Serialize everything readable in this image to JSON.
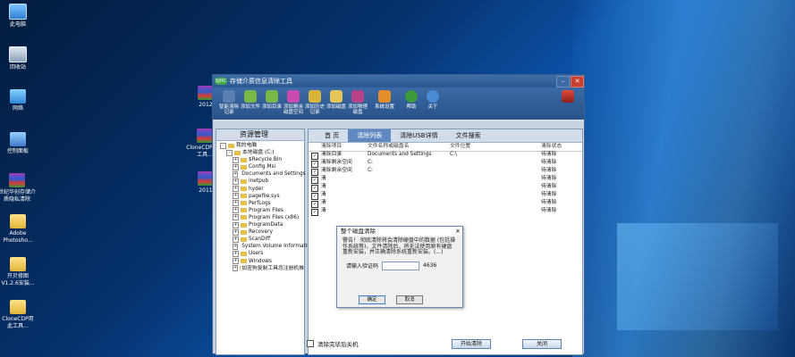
{
  "desktop": {
    "icons": [
      {
        "label": "此电脑",
        "icon": "computer-icon"
      },
      {
        "label": "回收站",
        "icon": "recycle-bin-icon"
      },
      {
        "label": "网络",
        "icon": "network-icon"
      },
      {
        "label": "控制面板",
        "icon": "control-panel-icon"
      },
      {
        "label": "世纪华创存储介质隐私清除",
        "icon": "app-icon"
      },
      {
        "label": "Adobe Photosho...",
        "icon": "folder-icon"
      },
      {
        "label": "开贝修图 V1.2.6安装...",
        "icon": "folder-icon"
      },
      {
        "label": "CloneCDP用此工具...",
        "icon": "folder-icon"
      }
    ],
    "rar_labels": [
      "2012",
      "CloneCDP用此工具...",
      "2011"
    ]
  },
  "window": {
    "title": "存储介质信息清除工具",
    "logo_text": "SJHC",
    "toolbar": [
      {
        "label": "智能清除记录",
        "icon": "broom-icon",
        "color": "#5a7fb0"
      },
      {
        "label": "添加文件",
        "icon": "file-icon",
        "color": "#7ab648"
      },
      {
        "label": "添加目录",
        "icon": "folder-add-icon",
        "color": "#7ab648"
      },
      {
        "label": "添加剩余磁盘空间",
        "icon": "disk-space-icon",
        "color": "#c94bb0"
      },
      {
        "label": "添加历史记录",
        "icon": "history-icon",
        "color": "#d9b43a"
      },
      {
        "label": "添加磁盘",
        "icon": "disk-icon",
        "color": "#e2c45a"
      },
      {
        "label": "添加物理磁盘",
        "icon": "physical-disk-icon",
        "color": "#b6428a"
      },
      {
        "label": "系统设置",
        "icon": "settings-icon",
        "color": "#e38c2c"
      },
      {
        "label": "帮助",
        "icon": "help-icon",
        "color": "#3d9a3a"
      },
      {
        "label": "关于",
        "icon": "about-icon",
        "color": "#4a8bd6"
      }
    ],
    "left_panel": {
      "title": "资源管理",
      "tree": [
        {
          "label": "我的电脑",
          "level": 0,
          "exp": "-"
        },
        {
          "label": "本地磁盘 (C:)",
          "level": 1,
          "exp": "-"
        },
        {
          "label": "$Recycle.Bin",
          "level": 2,
          "exp": "+"
        },
        {
          "label": "Config.Msi",
          "level": 2,
          "exp": "+"
        },
        {
          "label": "Documents and Settings",
          "level": 2,
          "exp": "+"
        },
        {
          "label": "inetpub",
          "level": 2,
          "exp": "+"
        },
        {
          "label": "hyder",
          "level": 2,
          "exp": "+"
        },
        {
          "label": "pagefile.sys",
          "level": 2,
          "exp": "+"
        },
        {
          "label": "PerfLogs",
          "level": 2,
          "exp": "+"
        },
        {
          "label": "Program Files",
          "level": 2,
          "exp": "+"
        },
        {
          "label": "Program Files (x86)",
          "level": 2,
          "exp": "+"
        },
        {
          "label": "ProgramData",
          "level": 2,
          "exp": "+"
        },
        {
          "label": "Recovery",
          "level": 2,
          "exp": "+"
        },
        {
          "label": "ScanDiff",
          "level": 2,
          "exp": "+"
        },
        {
          "label": "System Volume Informatic",
          "level": 2,
          "exp": "+"
        },
        {
          "label": "Users",
          "level": 2,
          "exp": "+"
        },
        {
          "label": "Windows",
          "level": 2,
          "exp": "+"
        },
        {
          "label": "加密狗复制工具忽注册机推",
          "level": 2,
          "exp": "+"
        }
      ]
    },
    "tabs": [
      "首 页",
      "清除列表",
      "清除USB详情",
      "文件搜索"
    ],
    "active_tab": 1,
    "table": {
      "headers": [
        "清除项目",
        "文件名称或磁盘名",
        "文件位置",
        "清除状态"
      ],
      "rows": [
        {
          "item": "清除目录",
          "name": "Documents and Settings",
          "loc": "C:\\",
          "status": "待清除"
        },
        {
          "item": "清除剩余空间",
          "name": "C:",
          "loc": "",
          "status": "待清除"
        },
        {
          "item": "清除剩余空间",
          "name": "C:",
          "loc": "",
          "status": "待清除"
        },
        {
          "item": "清",
          "name": "",
          "loc": "",
          "status": "待清除"
        },
        {
          "item": "清",
          "name": "",
          "loc": "",
          "status": "待清除"
        },
        {
          "item": "清",
          "name": "",
          "loc": "",
          "status": "待清除"
        },
        {
          "item": "清",
          "name": "",
          "loc": "",
          "status": "待清除"
        },
        {
          "item": "清",
          "name": "",
          "loc": "",
          "status": "待清除"
        }
      ]
    },
    "dialog": {
      "title": "整个磁盘清除",
      "message": "警告！ 彻底清除将会清除硬盘中的数据 (包括操作系统等)，文件清除后，将无法使用原有硬盘重新安装，并正确清除系统重新安装。(...)",
      "input_label": "请输入验证码",
      "code": "4636",
      "ok": "确定",
      "cancel": "取消"
    },
    "bottom": {
      "checkbox_label": "清除完毕后关机",
      "start": "开始清除",
      "close": "关闭"
    }
  }
}
